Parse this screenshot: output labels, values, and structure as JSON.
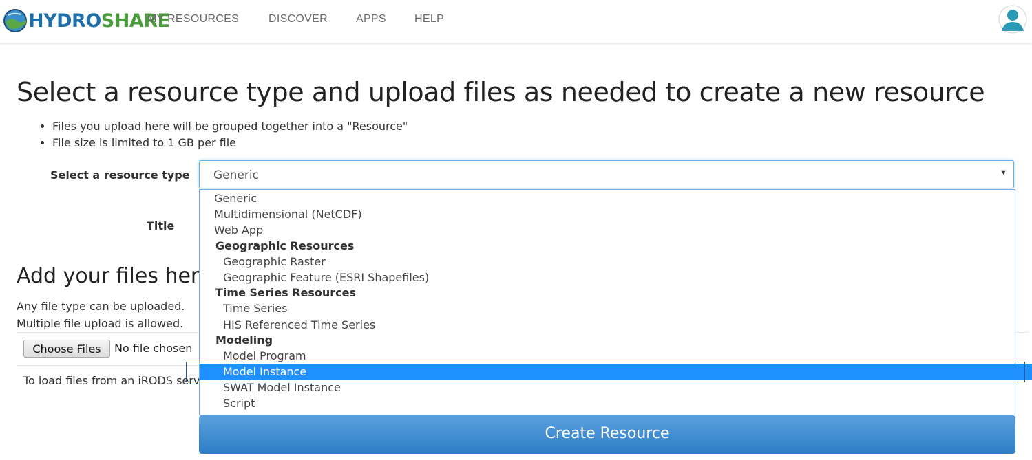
{
  "header": {
    "logo_part1": "HYDRO",
    "logo_part2": "SHARE",
    "nav": [
      "MY RESOURCES",
      "DISCOVER",
      "APPS",
      "HELP"
    ]
  },
  "page": {
    "title": "Select a resource type and upload files as needed to create a new resource",
    "notes": [
      "Files you upload here will be grouped together into a \"Resource\"",
      "File size is limited to 1 GB per file"
    ],
    "resource_type_label": "Select a resource type",
    "resource_type_value": "Generic",
    "title_label": "Title",
    "add_files_heading": "Add your files here:",
    "info_line1": "Any file type can be uploaded.",
    "info_line2": "Multiple file upload is allowed.",
    "choose_files_button": "Choose Files",
    "no_file_chosen": "No file chosen",
    "irods_text": "To load files from an iRODS serve",
    "create_button": "Create Resource"
  },
  "dropdown": {
    "options": [
      {
        "label": "Generic",
        "kind": "top"
      },
      {
        "label": "Multidimensional (NetCDF)",
        "kind": "top"
      },
      {
        "label": "Web App",
        "kind": "top"
      },
      {
        "label": "Geographic Resources",
        "kind": "group"
      },
      {
        "label": "Geographic Raster",
        "kind": "sub"
      },
      {
        "label": "Geographic Feature (ESRI Shapefiles)",
        "kind": "sub"
      },
      {
        "label": "Time Series Resources",
        "kind": "group"
      },
      {
        "label": "Time Series",
        "kind": "sub"
      },
      {
        "label": "HIS Referenced Time Series",
        "kind": "sub"
      },
      {
        "label": "Modeling",
        "kind": "group"
      },
      {
        "label": "Model Program",
        "kind": "sub"
      },
      {
        "label": "Model Instance",
        "kind": "sub",
        "selected": true
      },
      {
        "label": "SWAT Model Instance",
        "kind": "sub"
      },
      {
        "label": "Script",
        "kind": "sub"
      }
    ]
  },
  "colors": {
    "accent": "#1e90ff",
    "button": "#2d7ec6",
    "logo_blue": "#1f6fa8",
    "logo_green": "#4a9c3c"
  }
}
